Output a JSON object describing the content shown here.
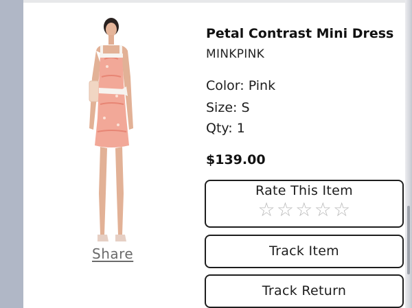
{
  "product": {
    "title": "Petal Contrast Mini Dress",
    "brand": "MINKPINK",
    "color": "Color: Pink",
    "size": "Size: S",
    "qty": "Qty: 1",
    "price": "$139.00",
    "image_icon": "product-photo"
  },
  "actions": {
    "share_label": "Share",
    "rate_label": "Rate This Item",
    "rating": {
      "value": 0,
      "max": 5,
      "glyph": "☆"
    },
    "track_item_label": "Track Item",
    "track_return_label": "Track Return"
  },
  "colors": {
    "dress_pink": "#f2a898",
    "trim_white": "#f7f3ef",
    "skin": "#e3b397",
    "rail": "#b0b7c6"
  }
}
